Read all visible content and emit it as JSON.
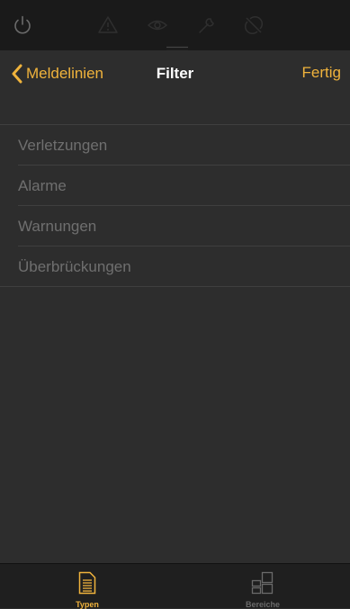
{
  "colors": {
    "accent": "#f0b33c",
    "background": "#2d2d2d",
    "topbar": "#1a1a1a",
    "item_text": "#6f6f6f",
    "separator": "#3f3f3f",
    "tab_inactive": "#6a6a6a"
  },
  "topbar": {
    "icons": [
      "power-icon",
      "warning-icon",
      "eye-icon",
      "wrench-icon",
      "bypass-icon"
    ]
  },
  "navbar": {
    "back_label": "Meldelinien",
    "title": "Filter",
    "done_label": "Fertig"
  },
  "list": {
    "items": [
      {
        "label": "Verletzungen"
      },
      {
        "label": "Alarme"
      },
      {
        "label": "Warnungen"
      },
      {
        "label": "Überbrückungen"
      }
    ]
  },
  "tabbar": {
    "tabs": [
      {
        "label": "Typen",
        "icon": "document-icon",
        "selected": true
      },
      {
        "label": "Bereiche",
        "icon": "grid-icon",
        "selected": false
      }
    ]
  }
}
